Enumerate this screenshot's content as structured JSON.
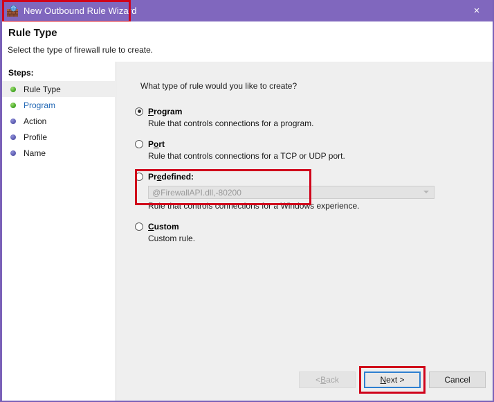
{
  "window": {
    "title": "New Outbound Rule Wizard",
    "icon": "firewall-icon",
    "close_label": "×",
    "accent_purple": "#8067BE",
    "highlight_red": "#D0021B"
  },
  "header": {
    "title": "Rule Type",
    "subtitle": "Select the type of firewall rule to create."
  },
  "sidebar": {
    "title": "Steps:",
    "items": [
      {
        "label": "Rule Type",
        "state": "current",
        "bullet": "green"
      },
      {
        "label": "Program",
        "state": "link",
        "bullet": "green"
      },
      {
        "label": "Action",
        "state": "pending",
        "bullet": "blue"
      },
      {
        "label": "Profile",
        "state": "pending",
        "bullet": "blue"
      },
      {
        "label": "Name",
        "state": "pending",
        "bullet": "blue"
      }
    ]
  },
  "main": {
    "question": "What type of rule would you like to create?",
    "options": [
      {
        "label": "Program",
        "accel": "P",
        "rest": "rogram",
        "description": "Rule that controls connections for a program.",
        "selected": true,
        "highlighted": true
      },
      {
        "label": "Port",
        "accel_prefix": "P",
        "accel": "o",
        "rest": "rt",
        "description": "Rule that controls connections for a TCP or UDP port.",
        "selected": false,
        "highlighted": false
      },
      {
        "label": "Predefined:",
        "accel_prefix": "Pr",
        "accel": "e",
        "rest": "defined:",
        "description": "Rule that controls connections for a Windows experience.",
        "selected": false,
        "highlighted": false,
        "combo": {
          "value": "@FirewallAPI.dll,-80200",
          "enabled": false,
          "arrow": "chevron-down-icon"
        }
      },
      {
        "label": "Custom",
        "accel": "C",
        "rest": "ustom",
        "description": "Custom rule.",
        "selected": false,
        "highlighted": false
      }
    ]
  },
  "footer": {
    "back": {
      "prefix": "< ",
      "accel": "B",
      "rest": "ack",
      "disabled": true
    },
    "next": {
      "prefix": "",
      "accel": "N",
      "rest": "ext >",
      "default": true,
      "highlighted": true
    },
    "cancel": {
      "label": "Cancel",
      "disabled": false
    }
  }
}
